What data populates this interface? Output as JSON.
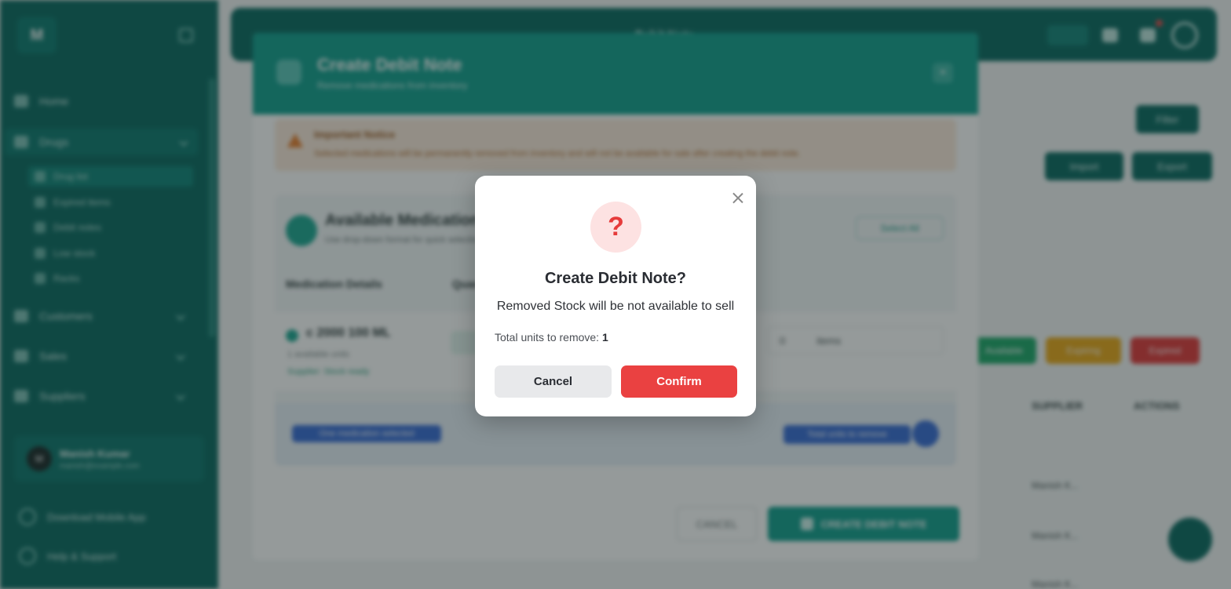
{
  "background": {
    "sidebar": {
      "logo": "M",
      "items": [
        {
          "label": "Home",
          "icon": "home-icon"
        },
        {
          "label": "Drugs",
          "icon": "folder-icon"
        },
        {
          "label": "Customers",
          "icon": "users-icon"
        },
        {
          "label": "Sales",
          "icon": "bag-icon"
        },
        {
          "label": "Suppliers",
          "icon": "truck-icon"
        }
      ],
      "sub_items": [
        {
          "label": "Drug list",
          "icon": "list-icon"
        },
        {
          "label": "Expired items",
          "icon": "clock-icon"
        },
        {
          "label": "Debit notes",
          "icon": "note-icon"
        },
        {
          "label": "Low stock",
          "icon": "alert-icon"
        },
        {
          "label": "Racks",
          "icon": "rack-icon"
        }
      ],
      "user": {
        "initials": "M",
        "name": "Manish Kumar",
        "email": "manish@example.com"
      },
      "footer": [
        {
          "label": "Download Mobile App",
          "icon": "phone-icon"
        },
        {
          "label": "Help & Support",
          "icon": "help-icon"
        }
      ]
    },
    "topbar": {
      "title": "Debit Note"
    },
    "right": {
      "buttons": [
        "Filter",
        "Import",
        "Export"
      ],
      "tags": [
        "Available",
        "Expiring",
        "Expired"
      ],
      "columns": [
        "SUPPLIER",
        "ACTIONS"
      ],
      "cells": [
        "Manish K...",
        "Manish K...",
        "Manish K..."
      ]
    },
    "modal": {
      "title": "Create Debit Note",
      "subtitle": "Remove medications from inventory",
      "notice_title": "Important Notice",
      "notice_text": "Selected medications will be permanently removed from inventory and will not be available for sale after creating the debit note.",
      "card_title": "Available Medications",
      "card_subtitle": "Use drop-down format for quick selection",
      "card_button": "Select All",
      "columns": [
        "Medication Details",
        "Quantity"
      ],
      "row": {
        "name": "c 2000 100 ML",
        "line1": "1 available units",
        "line2": "Supplier: Stock ready",
        "qty": "0",
        "unit": "items"
      },
      "summary_left": "One medication selected",
      "summary_right": "Total units to remove",
      "cancel": "CANCEL",
      "create": "CREATE DEBIT NOTE"
    }
  },
  "dialog": {
    "icon": "question-icon",
    "icon_glyph": "?",
    "title": "Create Debit Note?",
    "message": "Removed Stock will be not available to sell",
    "total_label": "Total units to remove:",
    "total_value": "1",
    "cancel_label": "Cancel",
    "confirm_label": "Confirm",
    "colors": {
      "confirm": "#ea4141",
      "icon_bg": "#fde2e2",
      "icon_fg": "#e63b3b"
    }
  }
}
